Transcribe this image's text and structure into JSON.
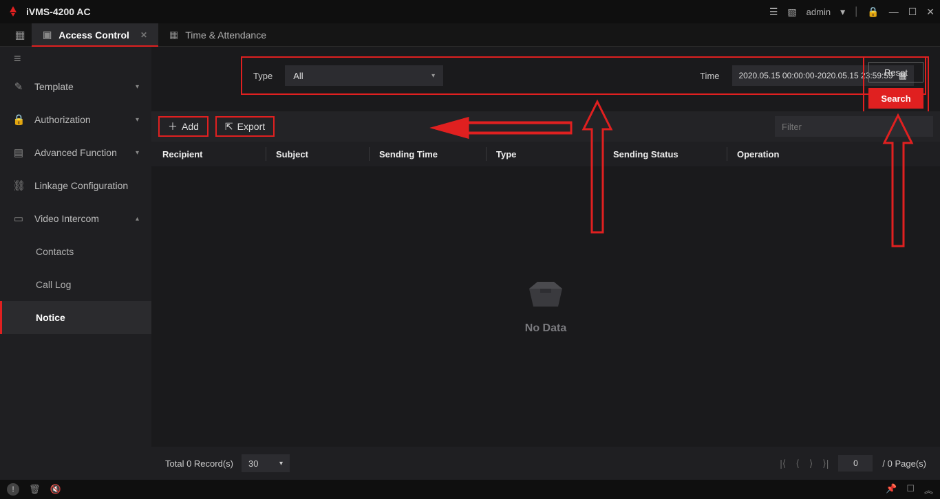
{
  "app": {
    "title": "iVMS-4200 AC"
  },
  "user": {
    "name": "admin"
  },
  "tabs": {
    "main": {
      "label": "Access Control"
    },
    "second": {
      "label": "Time & Attendance"
    }
  },
  "sidebar": {
    "template": "Template",
    "authorization": "Authorization",
    "advanced": "Advanced Function",
    "linkage": "Linkage Configuration",
    "video_intercom": "Video Intercom",
    "contacts": "Contacts",
    "call_log": "Call Log",
    "notice": "Notice"
  },
  "filter": {
    "type_label": "Type",
    "type_value": "All",
    "time_label": "Time",
    "time_value": "2020.05.15 00:00:00-2020.05.15 23:59:59"
  },
  "buttons": {
    "reset": "Reset",
    "search": "Search",
    "add": "Add",
    "export": "Export"
  },
  "filter_input": {
    "placeholder": "Filter"
  },
  "columns": {
    "recipient": "Recipient",
    "subject": "Subject",
    "sending_time": "Sending Time",
    "type": "Type",
    "sending_status": "Sending Status",
    "operation": "Operation"
  },
  "table": {
    "no_data": "No Data"
  },
  "pager": {
    "total_label": "Total 0 Record(s)",
    "page_size": "30",
    "current": "0",
    "pages_suffix": "/ 0 Page(s)"
  }
}
